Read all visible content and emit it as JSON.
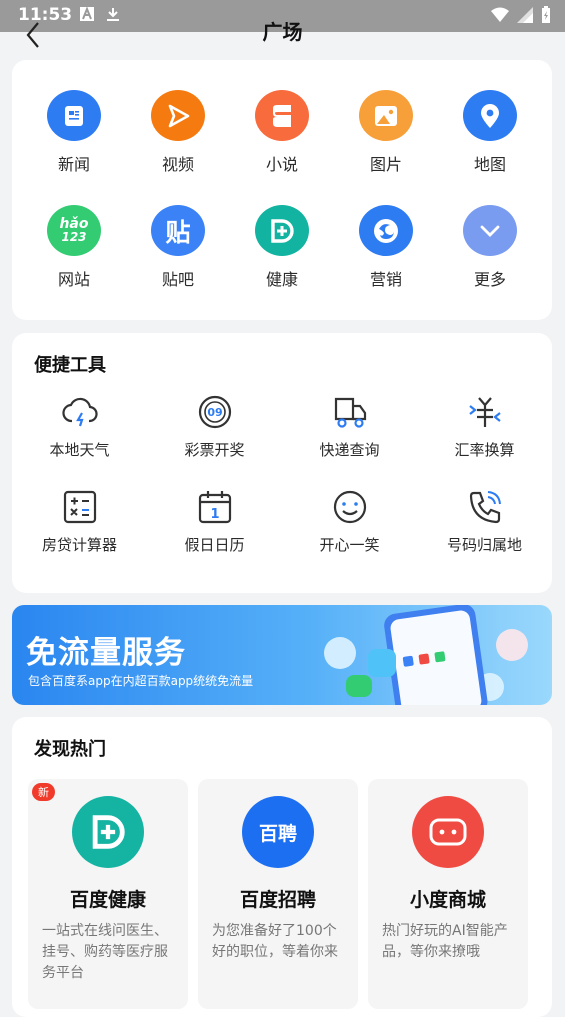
{
  "status_bar": {
    "time": "11:53"
  },
  "header": {
    "title": "广场"
  },
  "grid": [
    {
      "label": "新闻",
      "icon": "news-icon",
      "color": "#2d7cf2"
    },
    {
      "label": "视频",
      "icon": "play-icon",
      "color": "#f57b11"
    },
    {
      "label": "小说",
      "icon": "book-icon",
      "color": "#f76b3c"
    },
    {
      "label": "图片",
      "icon": "image-icon",
      "color": "#f7a03a"
    },
    {
      "label": "地图",
      "icon": "location-icon",
      "color": "#2d7cf2"
    },
    {
      "label": "网站",
      "icon": "hao123-icon",
      "color": "#33cc73",
      "icon_text": "hǎo\n123"
    },
    {
      "label": "贴吧",
      "icon": "tieba-icon",
      "color": "#3b82f6",
      "icon_text": "贴"
    },
    {
      "label": "健康",
      "icon": "health-icon",
      "color": "#12b3a0"
    },
    {
      "label": "营销",
      "icon": "marketing-icon",
      "color": "#2d7cf2"
    },
    {
      "label": "更多",
      "icon": "chevron-down-icon",
      "color": "#7a9cf0"
    }
  ],
  "tools": {
    "title": "便捷工具",
    "items": [
      {
        "label": "本地天气",
        "icon": "weather-icon"
      },
      {
        "label": "彩票开奖",
        "icon": "lottery-icon",
        "icon_text": "09"
      },
      {
        "label": "快递查询",
        "icon": "delivery-truck-icon"
      },
      {
        "label": "汇率换算",
        "icon": "currency-exchange-icon"
      },
      {
        "label": "房贷计算器",
        "icon": "calculator-icon"
      },
      {
        "label": "假日日历",
        "icon": "calendar-icon",
        "icon_text": "1"
      },
      {
        "label": "开心一笑",
        "icon": "smile-icon"
      },
      {
        "label": "号码归属地",
        "icon": "phone-icon"
      }
    ]
  },
  "banner": {
    "title": "免流量服务",
    "subtitle": "包含百度系app在内超百款app统统免流量"
  },
  "hot": {
    "title": "发现热门",
    "items": [
      {
        "badge": "新",
        "name": "百度健康",
        "desc": "一站式在线问医生、挂号、购药等医疗服务平台",
        "icon": "baidu-health-icon",
        "color": "#15b3a2"
      },
      {
        "badge": "",
        "name": "百度招聘",
        "desc": "为您准备好了100个好的职位，等着你来",
        "icon": "baidu-recruit-icon",
        "color": "#1d6ff2",
        "icon_text": "百聘"
      },
      {
        "badge": "",
        "name": "小度商城",
        "desc": "热门好玩的AI智能产品，等你来撩哦",
        "icon": "xiaodu-mall-icon",
        "color": "#f04b43"
      }
    ]
  }
}
